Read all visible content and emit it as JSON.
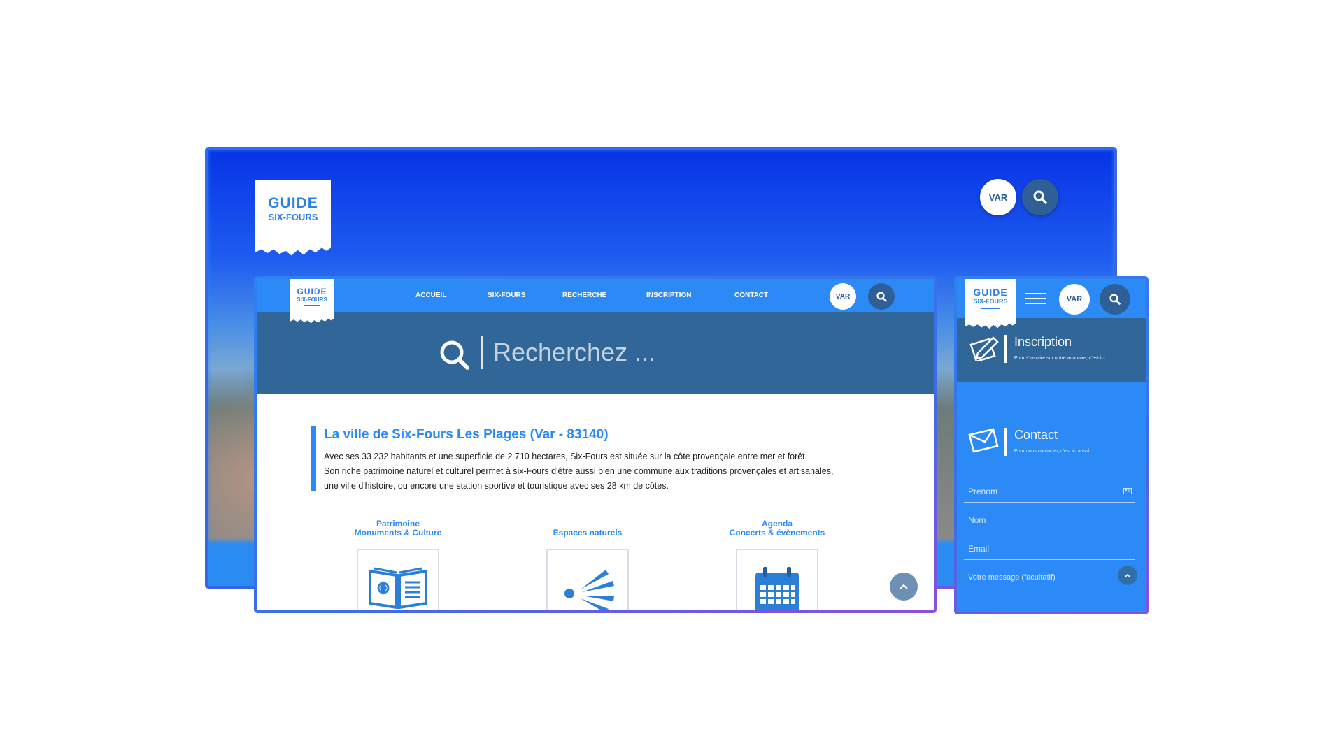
{
  "logo": {
    "line1": "GUIDE",
    "line2": "SIX-FOURS"
  },
  "var_label": "VAR",
  "nav": {
    "items": [
      {
        "label": "ACCUEIL"
      },
      {
        "label": "SIX-FOURS"
      },
      {
        "label": "RECHERCHE"
      },
      {
        "label": "INSCRIPTION"
      },
      {
        "label": "CONTACT"
      }
    ]
  },
  "search": {
    "placeholder": "Recherchez ..."
  },
  "intro": {
    "title": "La ville de Six-Fours Les Plages (Var - 83140)",
    "lines": [
      "Avec ses 33 232 habitants et une superficie de 2 710 hectares, Six-Fours est située sur la côte provençale entre mer et forêt.",
      "Son riche patrimoine naturel et culturel permet à six-Fours d'être aussi bien une commune aux traditions provençales et artisanales,",
      "une ville d'histoire, ou encore une station sportive et touristique avec ses 28 km de côtes."
    ]
  },
  "categories": [
    {
      "line1": "Patrimoine",
      "line2": "Monuments & Culture",
      "icon": "book-icon"
    },
    {
      "line1": "",
      "line2": "Espaces naturels",
      "icon": "sun-rays-icon"
    },
    {
      "line1": "Agenda",
      "line2": "Concerts & évènements",
      "icon": "calendar-icon"
    }
  ],
  "mobile": {
    "inscription": {
      "title": "Inscription",
      "subtitle": "Pour s'inscrire sur notre annuaire, c'est ici"
    },
    "contact": {
      "title": "Contact",
      "subtitle": "Pour nous contacter, c'est ici aussi"
    },
    "fields": [
      {
        "placeholder": "Prenom"
      },
      {
        "placeholder": "Nom"
      },
      {
        "placeholder": "Email"
      },
      {
        "placeholder": "Votre message (facultatif)"
      }
    ]
  },
  "colors": {
    "brand_blue": "#2b8af5",
    "dark_blue": "#316699",
    "frame_gradient_end": "#8c4fdf"
  }
}
